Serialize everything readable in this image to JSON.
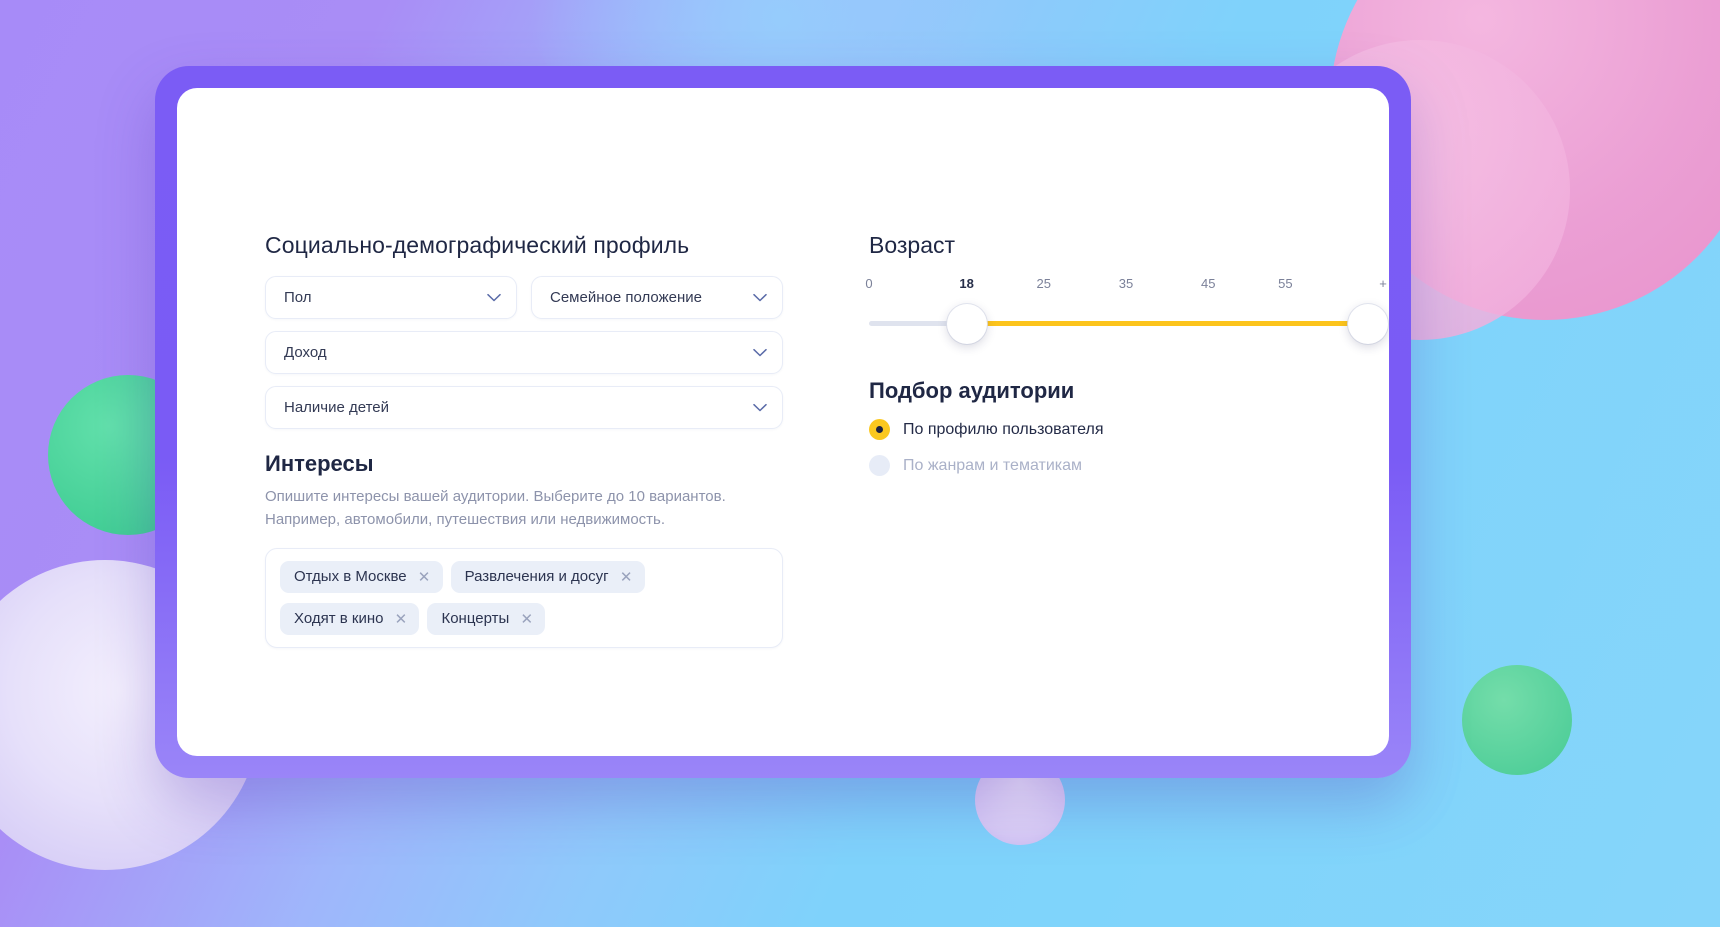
{
  "left_panel": {
    "title": "Социально-демографический профиль",
    "selects": [
      {
        "label": "Пол",
        "width": "half"
      },
      {
        "label": "Семейное положение",
        "width": "half"
      },
      {
        "label": "Доход",
        "width": "full"
      },
      {
        "label": "Наличие детей",
        "width": "full"
      }
    ],
    "interests": {
      "title": "Интересы",
      "hint_line1": "Опишите интересы вашей аудитории. Выберите до 10 вариантов.",
      "hint_line2": "Например, автомобили, путешествия или недвижимость.",
      "chips": [
        {
          "label": "Отдых в Москве",
          "remove": "✕"
        },
        {
          "label": "Развлечения и досуг",
          "remove": "✕"
        },
        {
          "label": "Ходят в кино",
          "remove": "✕"
        },
        {
          "label": "Концерты",
          "remove": "✕"
        }
      ]
    }
  },
  "right_panel": {
    "age": {
      "title": "Возраст",
      "ticks": [
        {
          "label": "0",
          "pos": 0,
          "active": false
        },
        {
          "label": "18",
          "pos": 19,
          "active": true
        },
        {
          "label": "25",
          "pos": 34,
          "active": false
        },
        {
          "label": "35",
          "pos": 50,
          "active": false
        },
        {
          "label": "45",
          "pos": 66,
          "active": false
        },
        {
          "label": "55",
          "pos": 81,
          "active": false
        },
        {
          "label": "+",
          "pos": 100,
          "active": false
        }
      ],
      "range_start_pct": 19,
      "range_end_pct": 97
    },
    "audience": {
      "title": "Подбор аудитории",
      "options": [
        {
          "label": "По профилю пользователя",
          "selected": true,
          "disabled": false
        },
        {
          "label": "По жанрам и тематикам",
          "selected": false,
          "disabled": true
        }
      ]
    }
  },
  "colors": {
    "accent_yellow": "#fbc81f",
    "frame_purple": "#7b5cf5",
    "track_gray": "#dfe3ee",
    "chip_bg": "#eaeff8",
    "text_dark": "#1f2744",
    "text_muted": "#8d93ab"
  }
}
